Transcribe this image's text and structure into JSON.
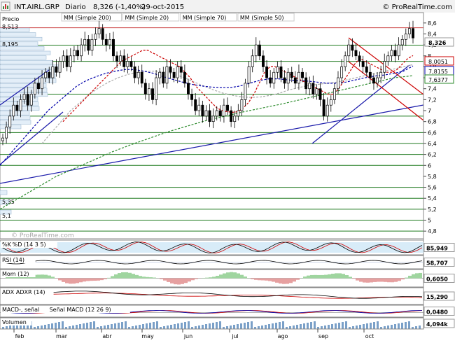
{
  "header": {
    "symbol": "INT.AIRL.GRP",
    "period": "Diario",
    "last": "8,326 (-1,40%)",
    "date": "29-oct-2015",
    "site": "© ProRealTime.com",
    "watermark": "© ProRealTime.com"
  },
  "legend": [
    {
      "label": "MM (Simple 200)",
      "color": "#2a8a2a"
    },
    {
      "label": "MM (Simple 20)",
      "color": "#cc0000"
    },
    {
      "label": "MM (Simple 70)",
      "color": "#0000aa"
    },
    {
      "label": "MM (Simple 50)",
      "color": "#9a9a9a"
    }
  ],
  "price_label": "Precio",
  "chart_data": {
    "type": "candlestick",
    "x_labels": [
      "feb",
      "mar",
      "abr",
      "may",
      "jun",
      "jul",
      "ago",
      "sep",
      "oct"
    ],
    "y_ticks": [
      "8,6",
      "8,4",
      "8,2",
      "8",
      "7,8",
      "7,6",
      "7,4",
      "7,2",
      "7",
      "6,8",
      "6,6",
      "6,4",
      "6,2",
      "6",
      "5,8",
      "5,6",
      "5,4",
      "5,2",
      "5",
      "4,8"
    ],
    "ylim": [
      4.7,
      8.7
    ],
    "volume_profile_labels": [
      "8,513",
      "8,195",
      "5,35",
      "5,1"
    ],
    "value_tags": [
      {
        "text": "8,326",
        "value": 8.326,
        "bg": "#ffffff",
        "fg": "#000000",
        "border": "#999999"
      },
      {
        "text": "8,0051",
        "value": 8.0051,
        "bg": "#ffffff",
        "fg": "#cc0000",
        "border": "#cc0000"
      },
      {
        "text": "7,8155",
        "value": 7.8155,
        "bg": "#ffffff",
        "fg": "#0000aa",
        "border": "#0000aa"
      },
      {
        "text": "7,6377",
        "value": 7.6377,
        "bg": "#ffffff",
        "fg": "#2a8a2a",
        "border": "#2a8a2a"
      }
    ],
    "close_series": [
      6.5,
      6.7,
      6.9,
      7.1,
      7.0,
      7.2,
      7.3,
      7.1,
      7.3,
      7.5,
      7.4,
      7.6,
      7.7,
      7.6,
      7.8,
      7.7,
      7.9,
      8.0,
      7.8,
      8.0,
      8.1,
      8.0,
      8.2,
      8.3,
      8.1,
      8.3,
      8.4,
      8.5,
      8.3,
      8.2,
      8.3,
      8.0,
      7.9,
      8.0,
      7.8,
      7.9,
      7.8,
      7.6,
      7.7,
      7.5,
      7.3,
      7.4,
      7.2,
      7.6,
      7.7,
      7.5,
      7.8,
      7.7,
      7.6,
      7.8,
      7.7,
      7.5,
      7.3,
      7.2,
      7.0,
      7.1,
      6.9,
      7.0,
      6.8,
      6.9,
      7.0,
      6.9,
      7.1,
      7.0,
      6.8,
      6.9,
      7.0,
      7.2,
      7.5,
      7.8,
      8.0,
      8.2,
      8.0,
      7.8,
      7.6,
      7.5,
      7.7,
      7.8,
      7.6,
      7.5,
      7.7,
      7.6,
      7.5,
      7.7,
      7.6,
      7.4,
      7.5,
      7.3,
      7.4,
      7.2,
      6.9,
      7.1,
      7.2,
      7.4,
      7.6,
      7.8,
      8.0,
      8.2,
      8.1,
      8.0,
      7.9,
      7.8,
      7.7,
      7.6,
      7.5,
      7.6,
      7.7,
      7.9,
      8.0,
      8.1,
      8.0,
      8.2,
      8.3,
      8.4,
      8.5,
      8.326
    ],
    "sma20_series": [
      6.8,
      6.9,
      7.0,
      7.1,
      7.2,
      7.3,
      7.4,
      7.5,
      7.6,
      7.7,
      7.8,
      7.9,
      7.95,
      8.0,
      8.05,
      8.1,
      8.1,
      8.05,
      8.0,
      7.95,
      7.9,
      7.85,
      7.8,
      7.7,
      7.6,
      7.45,
      7.35,
      7.25,
      7.15,
      7.05,
      7.0,
      6.98,
      6.97,
      6.98,
      7.05,
      7.15,
      7.3,
      7.5,
      7.7,
      7.8,
      7.8,
      7.75,
      7.7,
      7.65,
      7.6,
      7.55,
      7.5,
      7.45,
      7.4,
      7.35,
      7.3,
      7.3,
      7.4,
      7.55,
      7.7,
      7.85,
      7.95,
      7.9,
      7.85,
      7.8,
      7.75,
      7.7,
      7.7,
      7.75,
      7.85,
      7.95,
      8.0051
    ],
    "sma70_series": [
      6.0,
      6.2,
      6.4,
      6.6,
      6.8,
      7.0,
      7.15,
      7.3,
      7.45,
      7.55,
      7.62,
      7.68,
      7.72,
      7.75,
      7.75,
      7.72,
      7.68,
      7.62,
      7.57,
      7.52,
      7.48,
      7.45,
      7.43,
      7.42,
      7.42,
      7.45,
      7.5,
      7.55,
      7.58,
      7.58,
      7.56,
      7.55,
      7.54,
      7.52,
      7.5,
      7.5,
      7.52,
      7.56,
      7.6,
      7.63,
      7.65,
      7.68,
      7.72,
      7.8155
    ],
    "sma50_series": [
      6.4,
      6.6,
      6.8,
      7.0,
      7.15,
      7.3,
      7.42,
      7.52,
      7.6,
      7.66,
      7.7,
      7.72,
      7.72,
      7.7,
      7.66,
      7.6,
      7.52,
      7.45,
      7.38,
      7.32,
      7.28,
      7.25,
      7.24,
      7.25,
      7.28,
      7.32,
      7.38,
      7.42,
      7.46,
      7.48,
      7.5,
      7.52,
      7.56,
      7.6,
      7.64,
      7.68,
      7.72,
      7.76,
      7.8,
      7.84
    ],
    "sma200_series": [
      5.2,
      5.4,
      5.6,
      5.8,
      5.95,
      6.1,
      6.25,
      6.38,
      6.5,
      6.62,
      6.72,
      6.82,
      6.9,
      6.98,
      7.05,
      7.12,
      7.2,
      7.28,
      7.36,
      7.44,
      7.52,
      7.6,
      7.6377
    ],
    "horizontal_levels": [
      8.513,
      8.195,
      7.9,
      7.3,
      6.9,
      6.6,
      6.4,
      6.2,
      6.0,
      5.6,
      5.4,
      5.2,
      5.0,
      4.8
    ]
  },
  "indicators": [
    {
      "label": "%K",
      "label2": "%D (14 3 5)",
      "value": "85,949"
    },
    {
      "label": "RSI (14)",
      "label2": "",
      "value": "58,707"
    },
    {
      "label": "Mom (12)",
      "label2": "",
      "value": "0,6050"
    },
    {
      "label": "ADX",
      "label2": "ADXR (14)",
      "value": "15,290"
    },
    {
      "label": "MACD-, señal",
      "label2": "Señal  MACD (12 26 9)",
      "value": "0,0480"
    },
    {
      "label": "Volumen",
      "label2": "",
      "value": "4,094k"
    }
  ]
}
